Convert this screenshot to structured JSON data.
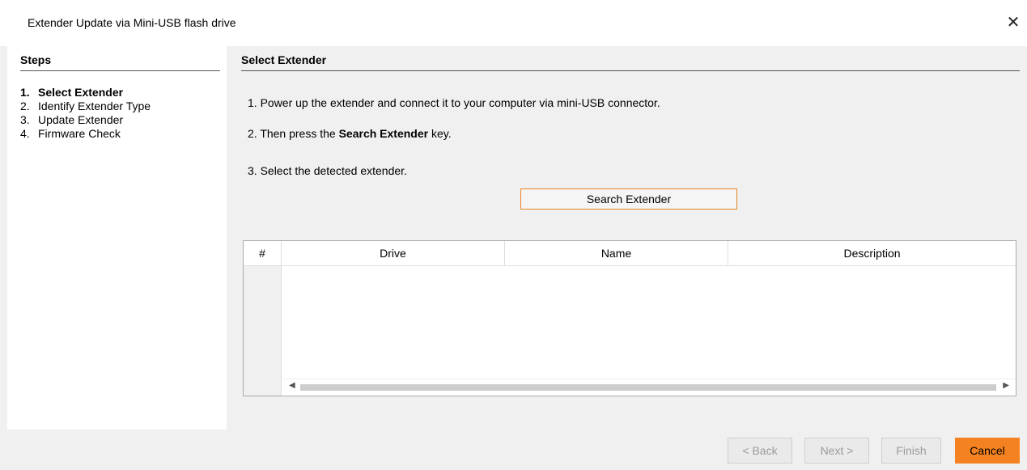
{
  "window": {
    "title": "Extender Update via Mini-USB flash drive",
    "close_glyph": "✕"
  },
  "sidebar": {
    "header": "Steps",
    "steps": [
      {
        "num": "1.",
        "label": "Select Extender",
        "active": true
      },
      {
        "num": "2.",
        "label": "Identify Extender Type",
        "active": false
      },
      {
        "num": "3.",
        "label": "Update Extender",
        "active": false
      },
      {
        "num": "4.",
        "label": "Firmware Check",
        "active": false
      }
    ]
  },
  "main": {
    "header": "Select Extender",
    "instructions": {
      "line1": "1.  Power up the extender and connect it to your computer via mini-USB connector.",
      "line2_prefix": "2.  Then press the ",
      "line2_bold": "Search Extender",
      "line2_suffix": " key.",
      "line3": "3.  Select the detected extender."
    },
    "search_button": "Search Extender",
    "table": {
      "columns": [
        "#",
        "Drive",
        "Name",
        "Description"
      ],
      "rows": []
    }
  },
  "footer": {
    "back": "< Back",
    "next": "Next >",
    "finish": "Finish",
    "cancel": "Cancel"
  },
  "colors": {
    "accent": "#f58220"
  }
}
